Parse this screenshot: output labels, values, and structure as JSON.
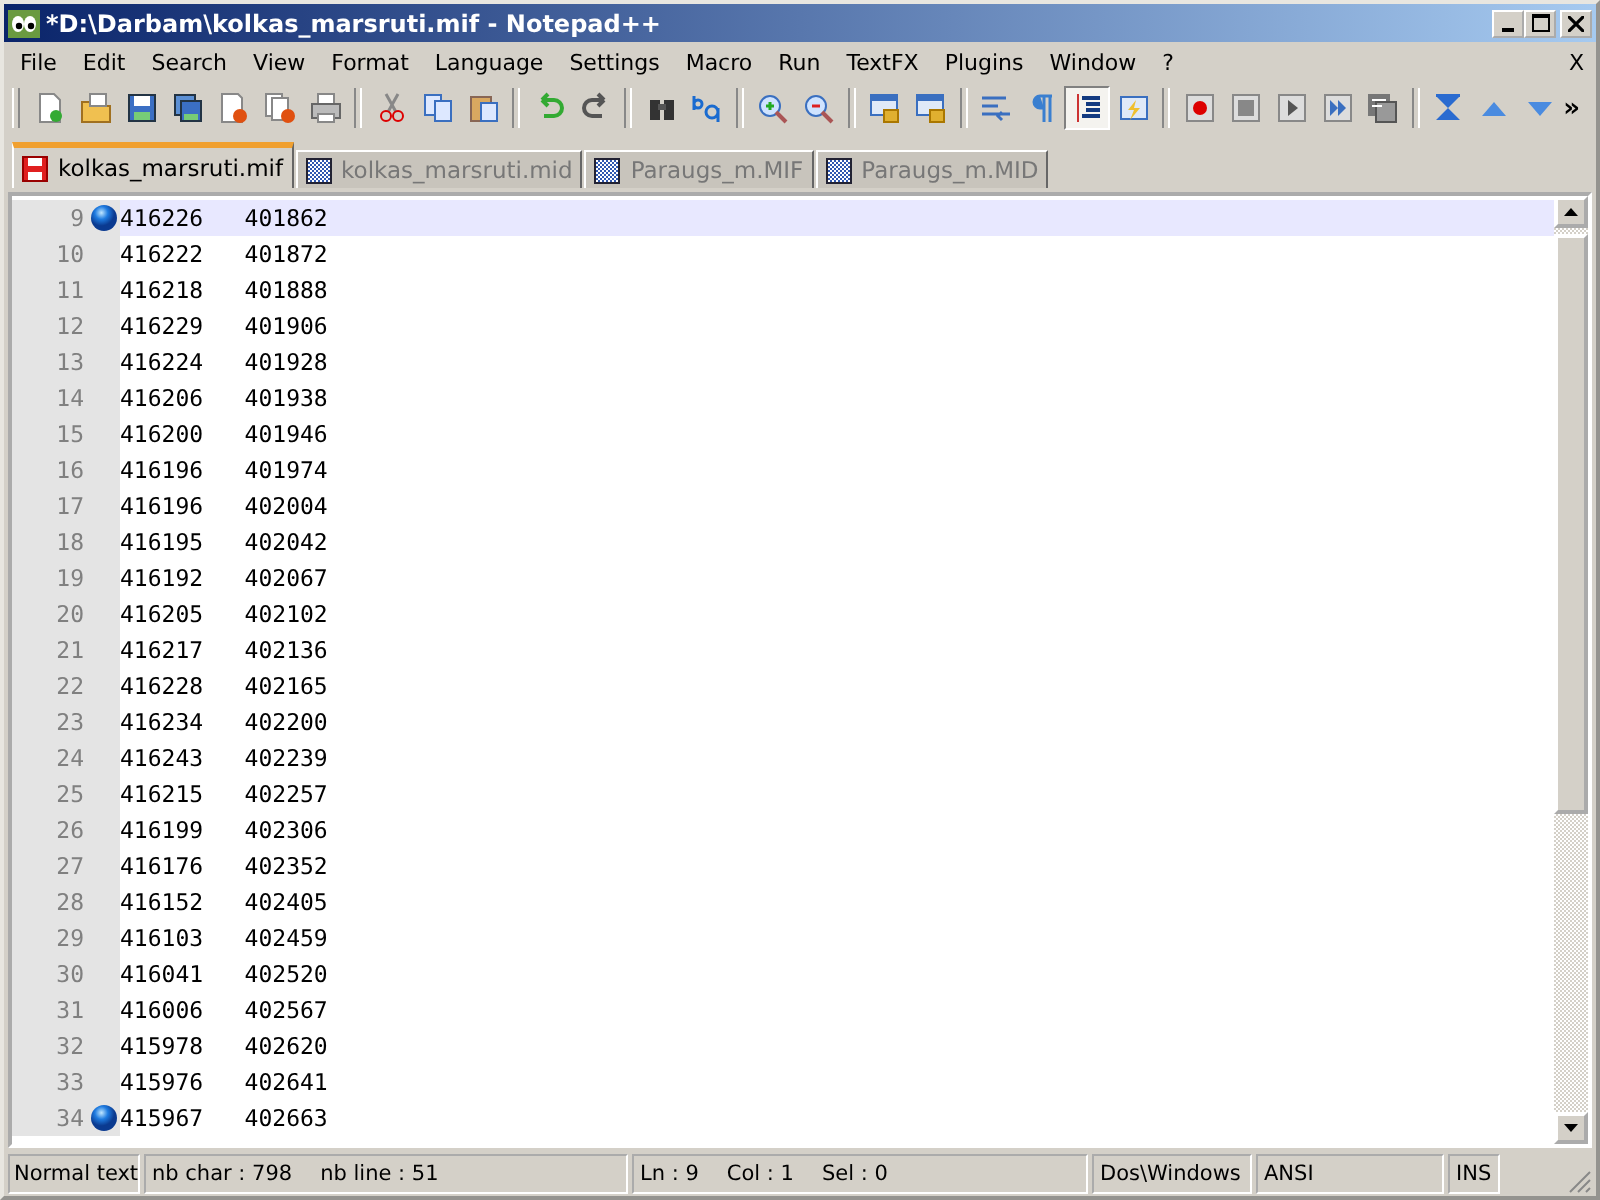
{
  "window": {
    "title": "*D:\\Darbam\\kolkas_marsruti.mif - Notepad++"
  },
  "menu": [
    "File",
    "Edit",
    "Search",
    "View",
    "Format",
    "Language",
    "Settings",
    "Macro",
    "Run",
    "TextFX",
    "Plugins",
    "Window",
    "?"
  ],
  "menu_close": "X",
  "toolbar": [
    {
      "kind": "new",
      "pressed": false
    },
    {
      "kind": "open",
      "pressed": false
    },
    {
      "kind": "save",
      "pressed": false
    },
    {
      "kind": "saveall",
      "pressed": false
    },
    {
      "kind": "close",
      "pressed": false
    },
    {
      "kind": "closeall",
      "pressed": false
    },
    {
      "kind": "print",
      "pressed": false
    },
    {
      "kind": "separator"
    },
    {
      "kind": "cut",
      "pressed": false
    },
    {
      "kind": "copy",
      "pressed": false
    },
    {
      "kind": "paste",
      "pressed": false
    },
    {
      "kind": "separator"
    },
    {
      "kind": "undo",
      "pressed": false
    },
    {
      "kind": "redo",
      "pressed": false
    },
    {
      "kind": "separator"
    },
    {
      "kind": "find",
      "pressed": false
    },
    {
      "kind": "replace",
      "pressed": false
    },
    {
      "kind": "separator"
    },
    {
      "kind": "zoomin",
      "pressed": false
    },
    {
      "kind": "zoomout",
      "pressed": false
    },
    {
      "kind": "separator"
    },
    {
      "kind": "lockwin",
      "pressed": false
    },
    {
      "kind": "lockwin",
      "pressed": false
    },
    {
      "kind": "separator"
    },
    {
      "kind": "wrap",
      "pressed": false
    },
    {
      "kind": "pilcrow",
      "pressed": false
    },
    {
      "kind": "indent",
      "pressed": true
    },
    {
      "kind": "bolt",
      "pressed": false
    },
    {
      "kind": "separator"
    },
    {
      "kind": "record",
      "pressed": false
    },
    {
      "kind": "stop",
      "pressed": false
    },
    {
      "kind": "play",
      "pressed": false
    },
    {
      "kind": "playmany",
      "pressed": false
    },
    {
      "kind": "savemacro",
      "pressed": false
    },
    {
      "kind": "separator"
    },
    {
      "kind": "sync",
      "pressed": false
    },
    {
      "kind": "up",
      "pressed": false
    },
    {
      "kind": "down",
      "pressed": false
    }
  ],
  "toolbar_more": "»",
  "tabs": [
    {
      "label": "kolkas_marsruti.mif",
      "selected": true,
      "modified": true
    },
    {
      "label": "kolkas_marsruti.mid",
      "selected": false,
      "modified": false
    },
    {
      "label": "Paraugs_m.MIF",
      "selected": false,
      "modified": false
    },
    {
      "label": "Paraugs_m.MID",
      "selected": false,
      "modified": false
    }
  ],
  "lines": [
    {
      "number": "9",
      "text": "416226   401862",
      "bookmark": true,
      "current": true
    },
    {
      "number": "10",
      "text": "416222   401872",
      "bookmark": false,
      "current": false
    },
    {
      "number": "11",
      "text": "416218   401888",
      "bookmark": false,
      "current": false
    },
    {
      "number": "12",
      "text": "416229   401906",
      "bookmark": false,
      "current": false
    },
    {
      "number": "13",
      "text": "416224   401928",
      "bookmark": false,
      "current": false
    },
    {
      "number": "14",
      "text": "416206   401938",
      "bookmark": false,
      "current": false
    },
    {
      "number": "15",
      "text": "416200   401946",
      "bookmark": false,
      "current": false
    },
    {
      "number": "16",
      "text": "416196   401974",
      "bookmark": false,
      "current": false
    },
    {
      "number": "17",
      "text": "416196   402004",
      "bookmark": false,
      "current": false
    },
    {
      "number": "18",
      "text": "416195   402042",
      "bookmark": false,
      "current": false
    },
    {
      "number": "19",
      "text": "416192   402067",
      "bookmark": false,
      "current": false
    },
    {
      "number": "20",
      "text": "416205   402102",
      "bookmark": false,
      "current": false
    },
    {
      "number": "21",
      "text": "416217   402136",
      "bookmark": false,
      "current": false
    },
    {
      "number": "22",
      "text": "416228   402165",
      "bookmark": false,
      "current": false
    },
    {
      "number": "23",
      "text": "416234   402200",
      "bookmark": false,
      "current": false
    },
    {
      "number": "24",
      "text": "416243   402239",
      "bookmark": false,
      "current": false
    },
    {
      "number": "25",
      "text": "416215   402257",
      "bookmark": false,
      "current": false
    },
    {
      "number": "26",
      "text": "416199   402306",
      "bookmark": false,
      "current": false
    },
    {
      "number": "27",
      "text": "416176   402352",
      "bookmark": false,
      "current": false
    },
    {
      "number": "28",
      "text": "416152   402405",
      "bookmark": false,
      "current": false
    },
    {
      "number": "29",
      "text": "416103   402459",
      "bookmark": false,
      "current": false
    },
    {
      "number": "30",
      "text": "416041   402520",
      "bookmark": false,
      "current": false
    },
    {
      "number": "31",
      "text": "416006   402567",
      "bookmark": false,
      "current": false
    },
    {
      "number": "32",
      "text": "415978   402620",
      "bookmark": false,
      "current": false
    },
    {
      "number": "33",
      "text": "415976   402641",
      "bookmark": false,
      "current": false
    },
    {
      "number": "34",
      "text": "415967   402663",
      "bookmark": true,
      "current": false
    }
  ],
  "status_bar": {
    "type": "Normal text",
    "chars": "nb char : 798",
    "lines": "nb line : 51",
    "ln": "Ln : 9",
    "col": "Col : 1",
    "sel": "Sel : 0",
    "eol": "Dos\\Windows",
    "encoding": "ANSI",
    "mode": "INS"
  }
}
